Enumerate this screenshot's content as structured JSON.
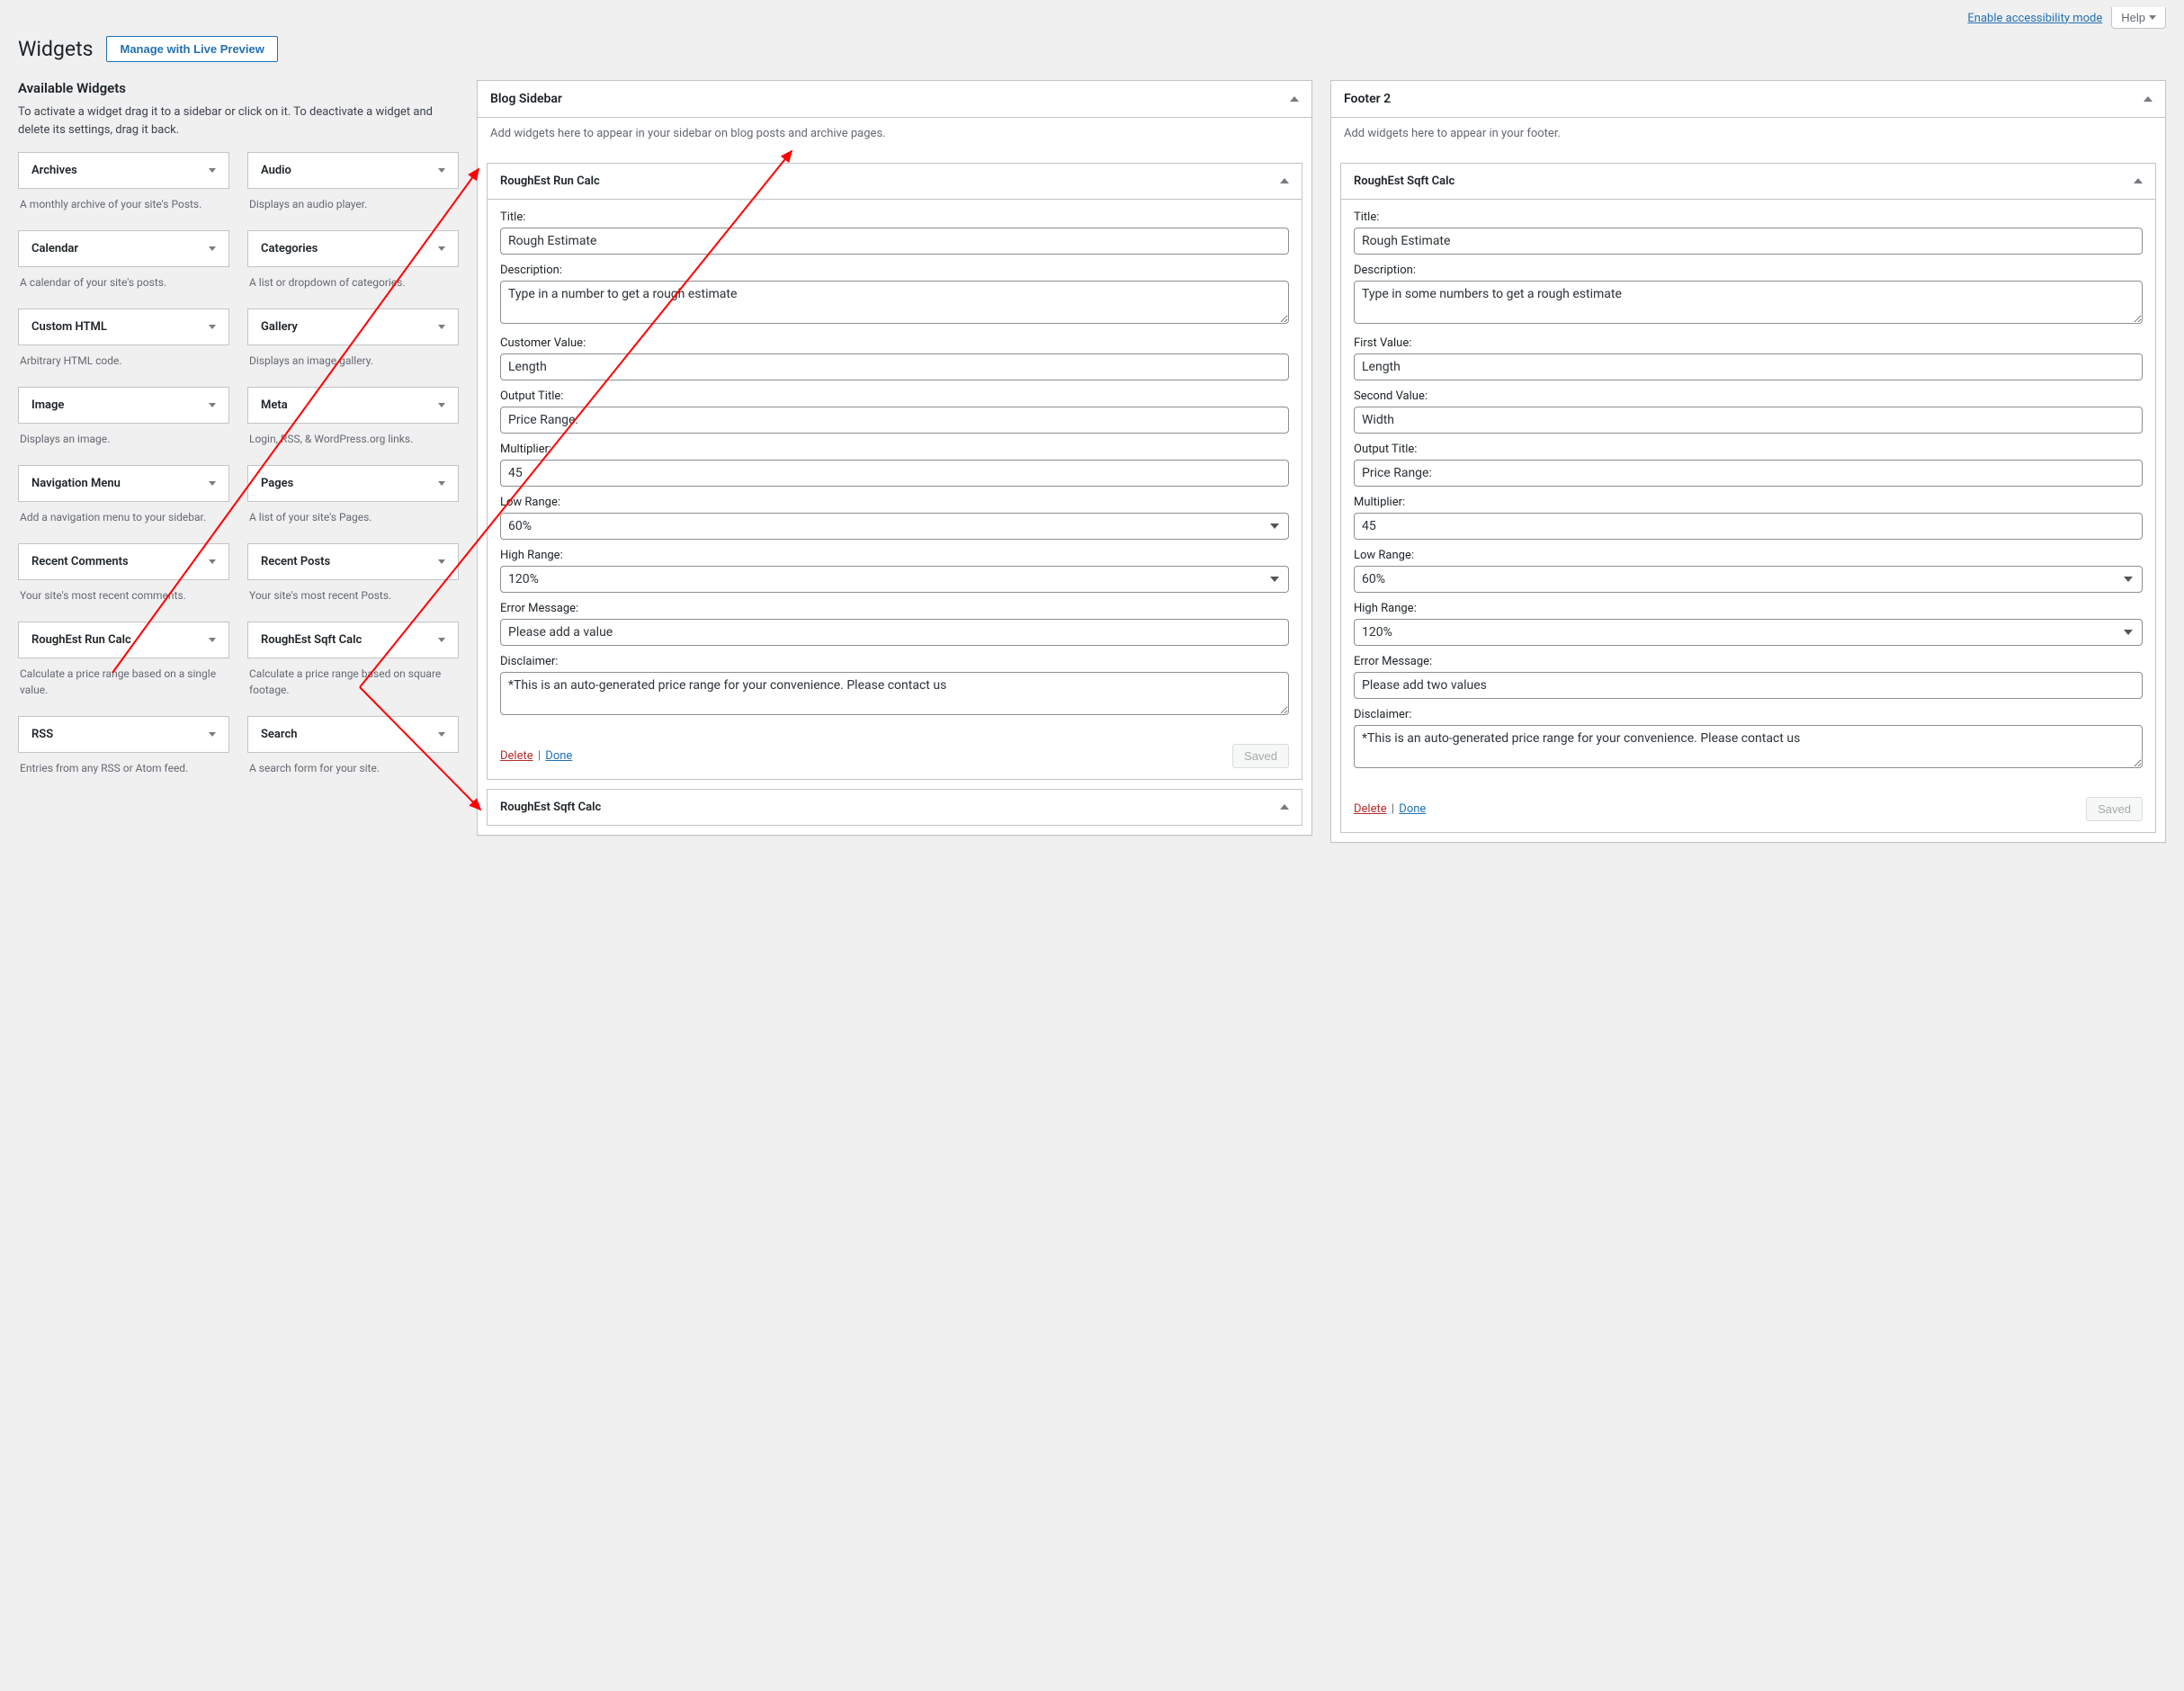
{
  "topbar": {
    "accessibility_link": "Enable accessibility mode",
    "help_label": "Help"
  },
  "header": {
    "title": "Widgets",
    "live_preview_btn": "Manage with Live Preview"
  },
  "available": {
    "title": "Available Widgets",
    "description": "To activate a widget drag it to a sidebar or click on it. To deactivate a widget and delete its settings, drag it back.",
    "widgets": [
      {
        "name": "Archives",
        "desc": "A monthly archive of your site's Posts."
      },
      {
        "name": "Audio",
        "desc": "Displays an audio player."
      },
      {
        "name": "Calendar",
        "desc": "A calendar of your site's posts."
      },
      {
        "name": "Categories",
        "desc": "A list or dropdown of categories."
      },
      {
        "name": "Custom HTML",
        "desc": "Arbitrary HTML code."
      },
      {
        "name": "Gallery",
        "desc": "Displays an image gallery."
      },
      {
        "name": "Image",
        "desc": "Displays an image."
      },
      {
        "name": "Meta",
        "desc": "Login, RSS, & WordPress.org links."
      },
      {
        "name": "Navigation Menu",
        "desc": "Add a navigation menu to your sidebar."
      },
      {
        "name": "Pages",
        "desc": "A list of your site's Pages."
      },
      {
        "name": "Recent Comments",
        "desc": "Your site's most recent comments."
      },
      {
        "name": "Recent Posts",
        "desc": "Your site's most recent Posts."
      },
      {
        "name": "RoughEst Run Calc",
        "desc": "Calculate a price range based on a single value."
      },
      {
        "name": "RoughEst Sqft Calc",
        "desc": "Calculate a price range based on square footage."
      },
      {
        "name": "RSS",
        "desc": "Entries from any RSS or Atom feed."
      },
      {
        "name": "Search",
        "desc": "A search form for your site."
      }
    ]
  },
  "labels": {
    "delete": "Delete",
    "done": "Done",
    "saved": "Saved"
  },
  "blog_sidebar": {
    "title": "Blog Sidebar",
    "description": "Add widgets here to appear in your sidebar on blog posts and archive pages.",
    "widget1": {
      "title": "RoughEst Run Calc",
      "fields": {
        "title_label": "Title:",
        "title_value": "Rough Estimate",
        "description_label": "Description:",
        "description_value": "Type in a number to get a rough estimate",
        "customer_value_label": "Customer Value:",
        "customer_value_value": "Length",
        "output_title_label": "Output Title:",
        "output_title_value": "Price Range:",
        "multiplier_label": "Multiplier:",
        "multiplier_value": "45",
        "low_range_label": "Low Range:",
        "low_range_value": "60%",
        "high_range_label": "High Range:",
        "high_range_value": "120%",
        "error_label": "Error Message:",
        "error_value": "Please add a value",
        "disclaimer_label": "Disclaimer:",
        "disclaimer_value": "*This is an auto-generated price range for your convenience. Please contact us"
      }
    },
    "widget2": {
      "title": "RoughEst Sqft Calc"
    }
  },
  "footer2": {
    "title": "Footer 2",
    "description": "Add widgets here to appear in your footer.",
    "widget1": {
      "title": "RoughEst Sqft Calc",
      "fields": {
        "title_label": "Title:",
        "title_value": "Rough Estimate",
        "description_label": "Description:",
        "description_value": "Type in some numbers to get a rough estimate",
        "first_value_label": "First Value:",
        "first_value_value": "Length",
        "second_value_label": "Second Value:",
        "second_value_value": "Width",
        "output_title_label": "Output Title:",
        "output_title_value": "Price Range:",
        "multiplier_label": "Multiplier:",
        "multiplier_value": "45",
        "low_range_label": "Low Range:",
        "low_range_value": "60%",
        "high_range_label": "High Range:",
        "high_range_value": "120%",
        "error_label": "Error Message:",
        "error_value": "Please add two values",
        "disclaimer_label": "Disclaimer:",
        "disclaimer_value": "*This is an auto-generated price range for your convenience. Please contact us"
      }
    }
  }
}
